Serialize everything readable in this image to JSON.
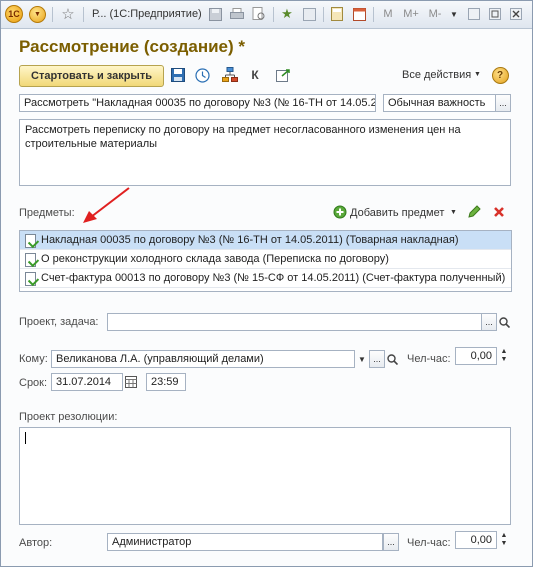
{
  "titlebar": {
    "title": "Р...  (1С:Предприятие)",
    "m_label": "M",
    "mplus_label": "M+",
    "mminus_label": "M-",
    "dropdown_glyph": "▼",
    "logo_text": "1С"
  },
  "form": {
    "heading": "Рассмотрение (создание) *",
    "start_close_label": "Стартовать и закрыть",
    "k_label": "К",
    "all_actions_label": "Все действия",
    "help_label": "?"
  },
  "fields": {
    "subject_value": "Рассмотреть \"Накладная 00035 по договору №3 (№ 16-ТН от 14.05.2",
    "importance_value": "Обычная важность",
    "description_value": "Рассмотреть переписку по договору на предмет несогласованного изменения цен на строительные материалы",
    "items_label": "Предметы:",
    "add_item_label": "Добавить предмет",
    "project_label": "Проект, задача:",
    "project_value": "",
    "to_label": "Кому:",
    "to_value": "Великанова Л.А. (управляющий делами)",
    "hours_label_1": "Чел-час:",
    "hours_value_1": "0,00",
    "due_label": "Срок:",
    "due_date": "31.07.2014",
    "due_time": "23:59",
    "resolution_label": "Проект резолюции:",
    "resolution_value": "",
    "author_label": "Автор:",
    "author_value": "Администратор",
    "hours_label_2": "Чел-час:",
    "hours_value_2": "0,00",
    "dots": "...",
    "spin_up": "▲",
    "spin_down": "▼"
  },
  "items": [
    {
      "text": "Накладная 00035 по договору №3 (№ 16-ТН от 14.05.2011) (Товарная накладная)",
      "selected": true
    },
    {
      "text": "О реконструкции холодного склада завода (Переписка по договору)",
      "selected": false
    },
    {
      "text": "Счет-фактура 00013 по договору №3 (№ 15-СФ от 14.05.2011) (Счет-фактура полученный)",
      "selected": false
    }
  ],
  "colors": {
    "heading": "#7b5e00",
    "selection": "#c9dff6",
    "arrow": "#e02020"
  }
}
